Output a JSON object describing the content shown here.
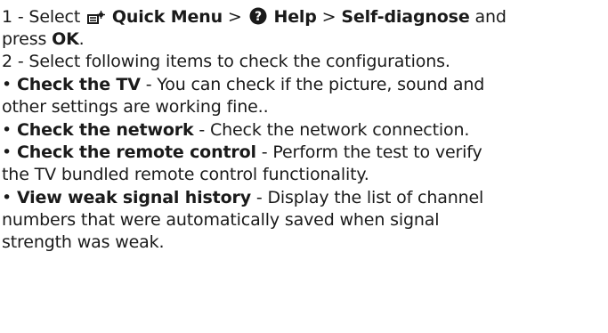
{
  "step1": {
    "prefix": "1 - Select",
    "quick_menu": "Quick Menu",
    "sep1": ">",
    "help": "Help",
    "sep2": ">",
    "self_diagnose": "Self-diagnose",
    "and": "and",
    "press": "press",
    "ok": "OK",
    "period": ".",
    "icons": [
      "quick-menu-icon",
      "help-icon"
    ]
  },
  "step2": {
    "text": "2 - Select following items to check the configurations."
  },
  "items": [
    {
      "bullet": "•",
      "title": "Check the TV",
      "desc_line1": " - You can check if the picture, sound and",
      "desc_line2": "other settings are working fine.."
    },
    {
      "bullet": "•",
      "title": "Check the network",
      "desc_line1": " - Check the network connection.",
      "desc_line2": ""
    },
    {
      "bullet": "•",
      "title": "Check the remote control",
      "desc_line1": " - Perform the test to verify",
      "desc_line2": "the TV bundled  remote control functionality."
    },
    {
      "bullet": "•",
      "title": "View weak signal history",
      "desc_line1": " - Display the  list of channel",
      "desc_line2": "numbers that were automatically saved when signal",
      "desc_line3": "strength was weak."
    }
  ]
}
